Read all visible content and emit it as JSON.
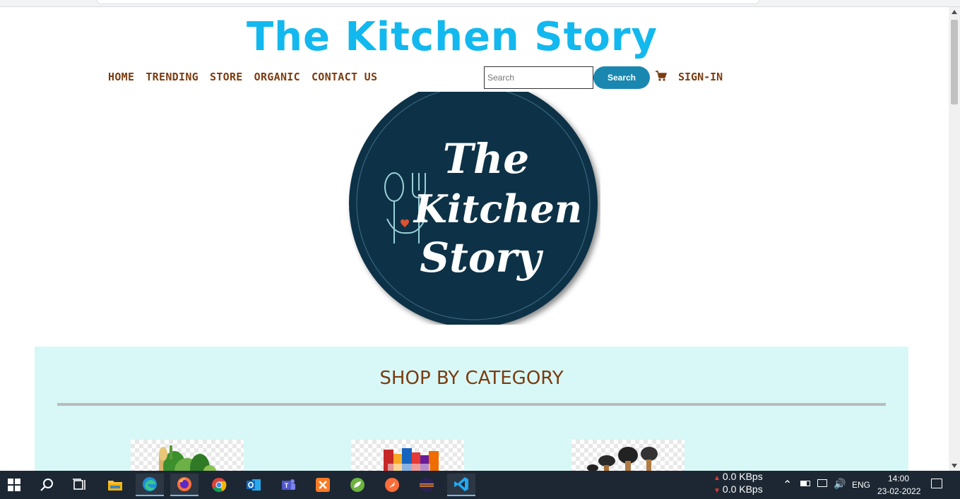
{
  "site": {
    "title": "The Kitchen Story",
    "nav": [
      "HOME",
      "TRENDING",
      "STORE",
      "ORGANIC",
      "CONTACT US"
    ],
    "search_placeholder": "Search",
    "search_button": "Search",
    "signin": "SIGN-IN"
  },
  "logo": {
    "line1": "The",
    "line2": "Kitchen",
    "line3": "Story",
    "bg_color": "#0f3147"
  },
  "category": {
    "heading": "SHOP BY CATEGORY"
  },
  "taskbar": {
    "net_up": "0.0 KBps",
    "net_down": "0.0 KBps",
    "lang": "ENG",
    "time": "14:00",
    "date": "23-02-2022",
    "apps": [
      "windows-start-icon",
      "search-icon",
      "task-view-icon",
      "file-explorer-icon",
      "edge-icon",
      "firefox-icon",
      "chrome-icon",
      "outlook-icon",
      "teams-icon",
      "xampp-icon",
      "spring-icon",
      "postman-icon",
      "eclipse-icon",
      "vscode-icon"
    ]
  },
  "colors": {
    "title": "#12b8ee",
    "nav": "#7b3c10",
    "search_button": "#1a87b0",
    "category_bg": "#d7f8f7",
    "taskbar": "#1c2733"
  }
}
